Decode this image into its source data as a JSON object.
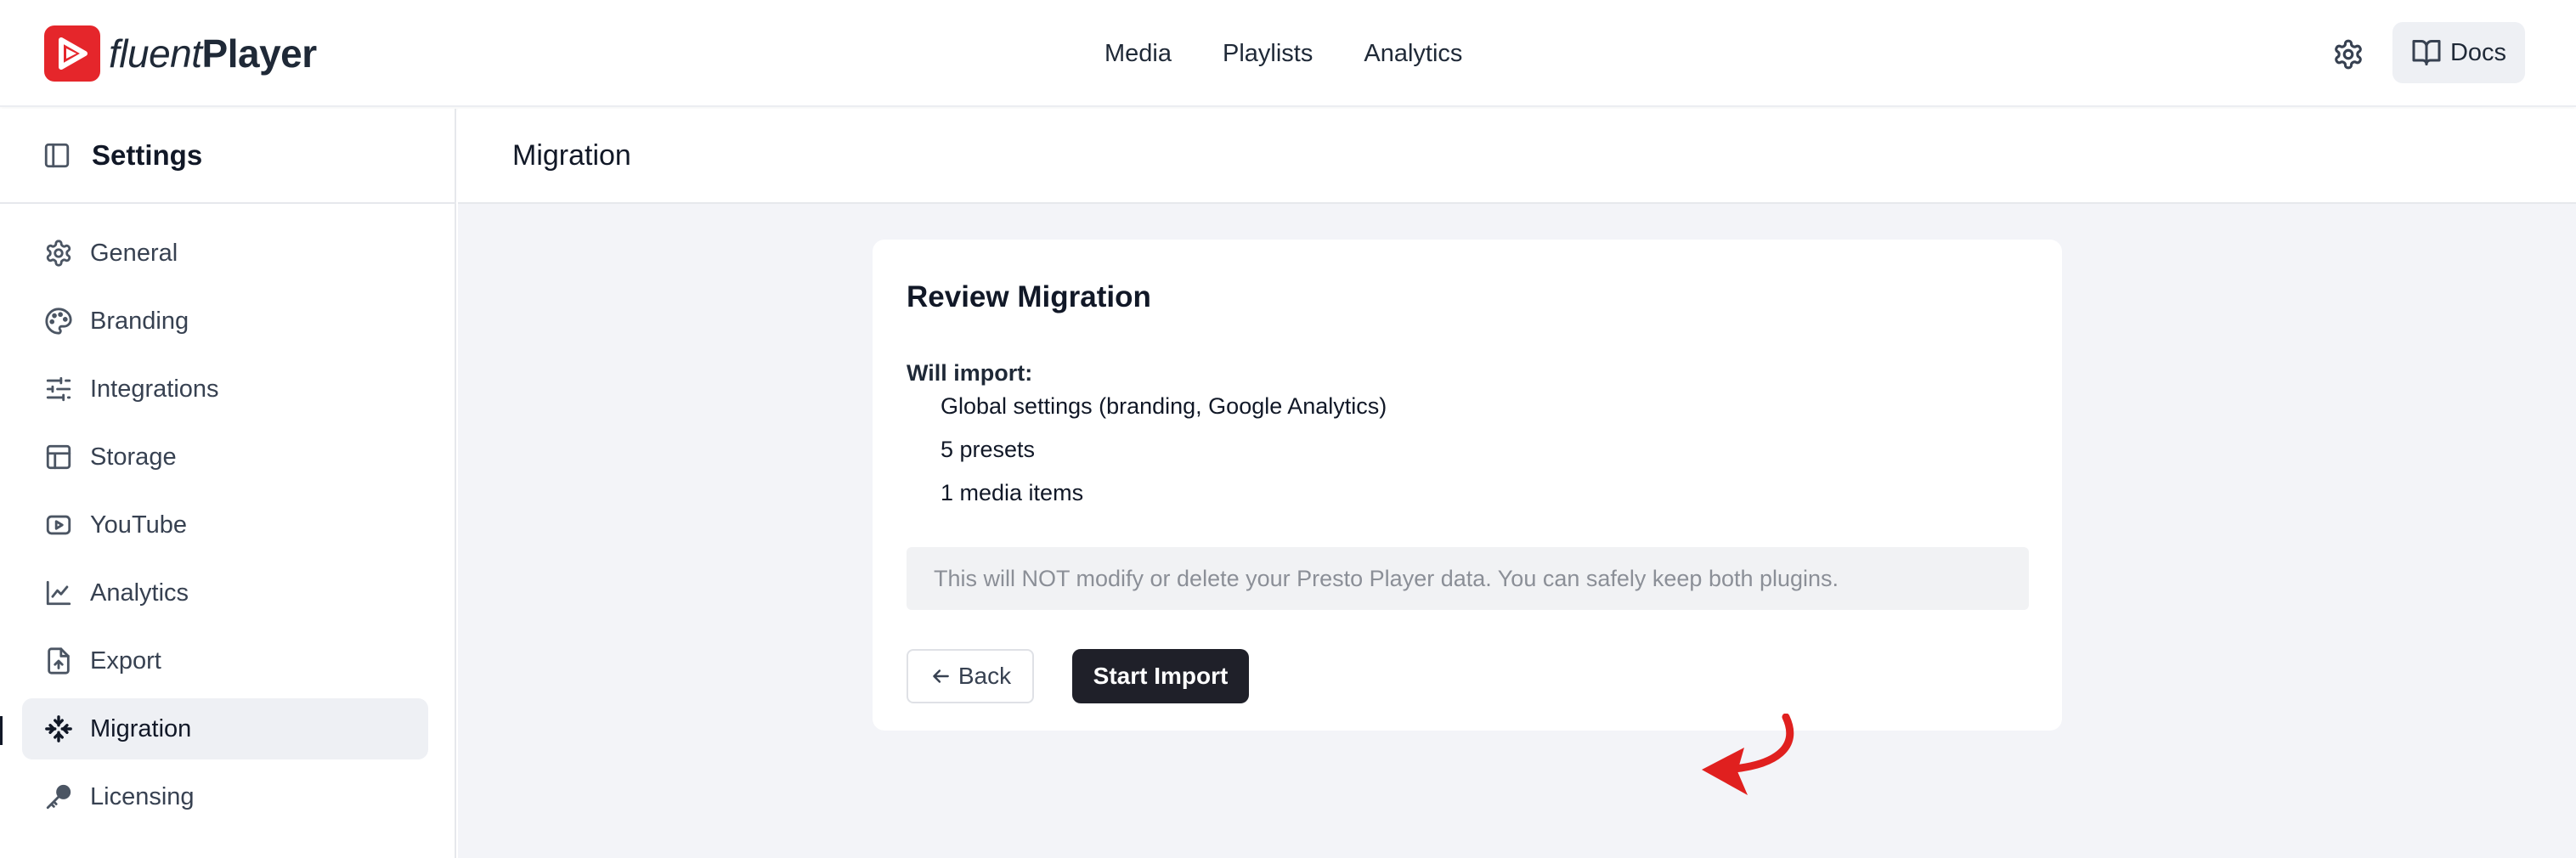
{
  "brand": {
    "name_light": "fluent",
    "name_bold": "Player",
    "accent": "#e5262b"
  },
  "header": {
    "nav": [
      "Media",
      "Playlists",
      "Analytics"
    ],
    "docs_label": "Docs",
    "settings_icon": "gear-icon",
    "docs_icon": "book-open-icon"
  },
  "sidebar": {
    "title": "Settings",
    "items": [
      {
        "label": "General",
        "icon": "gear-icon",
        "active": false
      },
      {
        "label": "Branding",
        "icon": "palette-icon",
        "active": false
      },
      {
        "label": "Integrations",
        "icon": "sliders-icon",
        "active": false
      },
      {
        "label": "Storage",
        "icon": "layout-icon",
        "active": false
      },
      {
        "label": "YouTube",
        "icon": "youtube-icon",
        "active": false
      },
      {
        "label": "Analytics",
        "icon": "line-chart-icon",
        "active": false
      },
      {
        "label": "Export",
        "icon": "export-icon",
        "active": false
      },
      {
        "label": "Migration",
        "icon": "migration-icon",
        "active": true
      },
      {
        "label": "Licensing",
        "icon": "key-icon",
        "active": false
      }
    ]
  },
  "main": {
    "page_title": "Migration",
    "card": {
      "title": "Review Migration",
      "will_import_label": "Will import:",
      "import_items": [
        "Global settings (branding, Google Analytics)",
        "5 presets",
        "1 media items"
      ],
      "notice": "This will NOT modify or delete your Presto Player data. You can safely keep both plugins.",
      "back_label": "Back",
      "start_label": "Start Import"
    }
  },
  "annotation": {
    "color": "#e0201f"
  }
}
